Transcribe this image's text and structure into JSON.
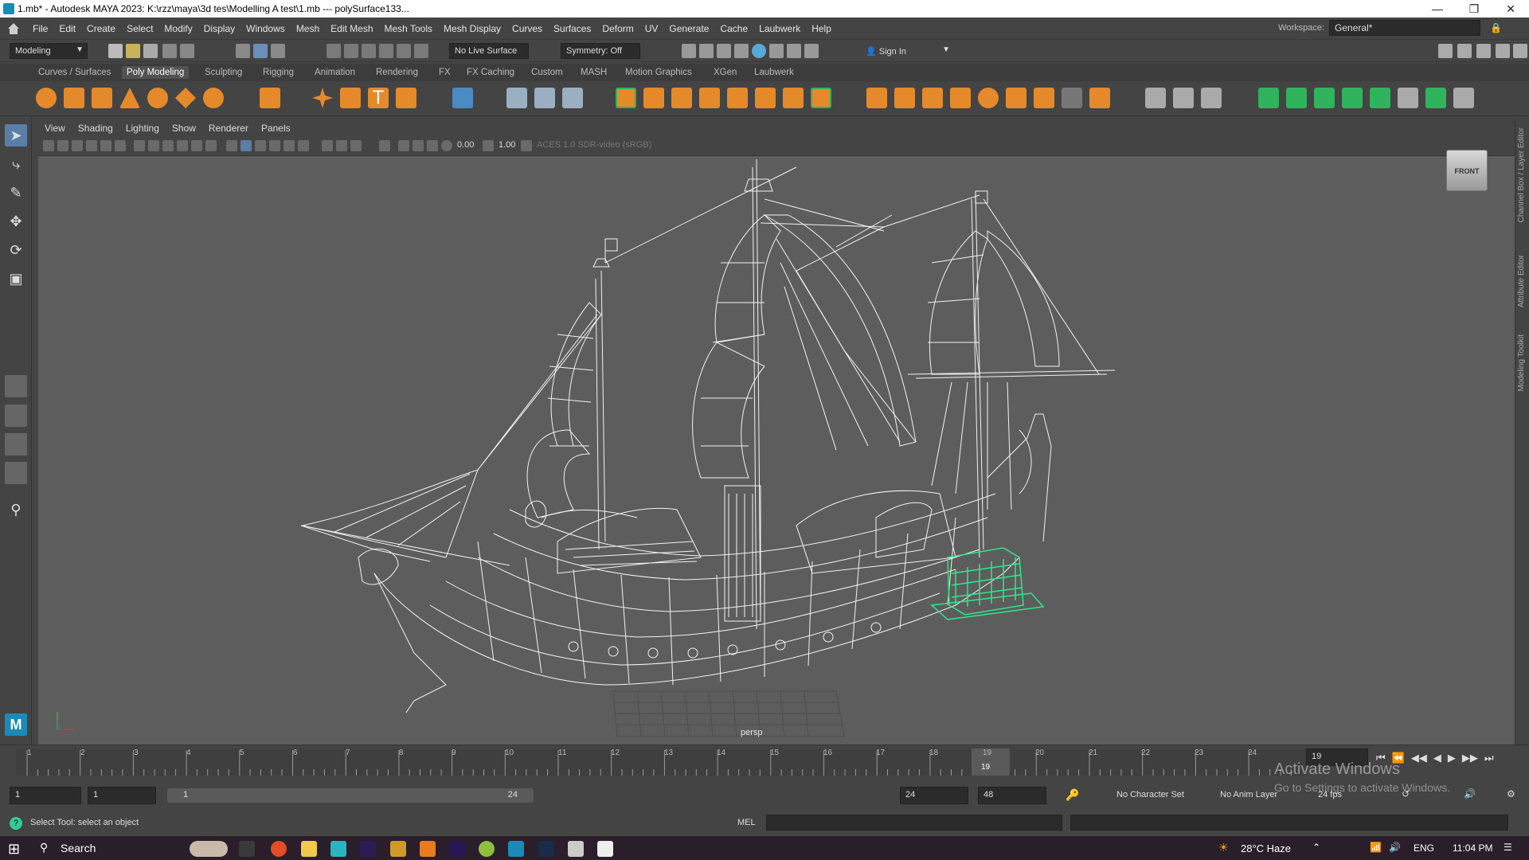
{
  "window": {
    "title": "1.mb* - Autodesk MAYA 2023: K:\\rzz\\maya\\3d tes\\Modelling A test\\1.mb   ---   polySurface133...",
    "min_icon": "minimize-icon",
    "max_icon": "restore-icon",
    "close_icon": "close-icon"
  },
  "menubar": {
    "items": [
      "File",
      "Edit",
      "Create",
      "Select",
      "Modify",
      "Display",
      "Windows",
      "Mesh",
      "Edit Mesh",
      "Mesh Tools",
      "Mesh Display",
      "Curves",
      "Surfaces",
      "Deform",
      "UV",
      "Generate",
      "Cache",
      "Laubwerk",
      "Help"
    ],
    "workspace_label": "Workspace:",
    "workspace_value": "General*"
  },
  "statusline": {
    "menuset": "Modeling",
    "live_surface": "No Live Surface",
    "symmetry": "Symmetry: Off",
    "signin": "Sign In"
  },
  "shelf": {
    "tabs": [
      "Curves / Surfaces",
      "Poly Modeling",
      "Sculpting",
      "Rigging",
      "Animation",
      "Rendering",
      "FX",
      "FX Caching",
      "Custom",
      "MASH",
      "Motion Graphics",
      "XGen",
      "Laubwerk"
    ],
    "active_tab": "Poly Modeling",
    "accent": "#e58a2a",
    "green": "#2fb35c"
  },
  "viewport": {
    "menu": [
      "View",
      "Shading",
      "Lighting",
      "Show",
      "Renderer",
      "Panels"
    ],
    "field1": "0.00",
    "field2": "1.00",
    "colorspace": "ACES 1.0 SDR-video (sRGB)",
    "camera_label": "persp",
    "viewcube_label": "FRONT",
    "selection_color": "#2fe88a",
    "wire_color": "#ffffff"
  },
  "right_tabs": [
    "Channel Box / Layer Editor",
    "Attribute Editor",
    "Modeling Toolkit"
  ],
  "timeline": {
    "ticks": [
      "1",
      "2",
      "3",
      "4",
      "5",
      "6",
      "7",
      "8",
      "9",
      "10",
      "11",
      "12",
      "13",
      "14",
      "15",
      "16",
      "17",
      "18",
      "19",
      "20",
      "21",
      "22",
      "23",
      "24"
    ],
    "current_frame": "19",
    "current_field": "19"
  },
  "range": {
    "start": "1",
    "start2": "1",
    "range_start": "1",
    "range_end": "24",
    "end": "24",
    "end2": "48",
    "character_set": "No Character Set",
    "anim_layer": "No Anim Layer",
    "fps": "24 fps"
  },
  "helpline": {
    "text": "Select Tool: select an object",
    "mel": "MEL"
  },
  "watermark": {
    "line1": "Activate Windows",
    "line2": "Go to Settings to activate Windows."
  },
  "taskbar": {
    "search": "Search",
    "weather": "28°C  Haze",
    "lang": "ENG",
    "time": "11:04 PM"
  }
}
